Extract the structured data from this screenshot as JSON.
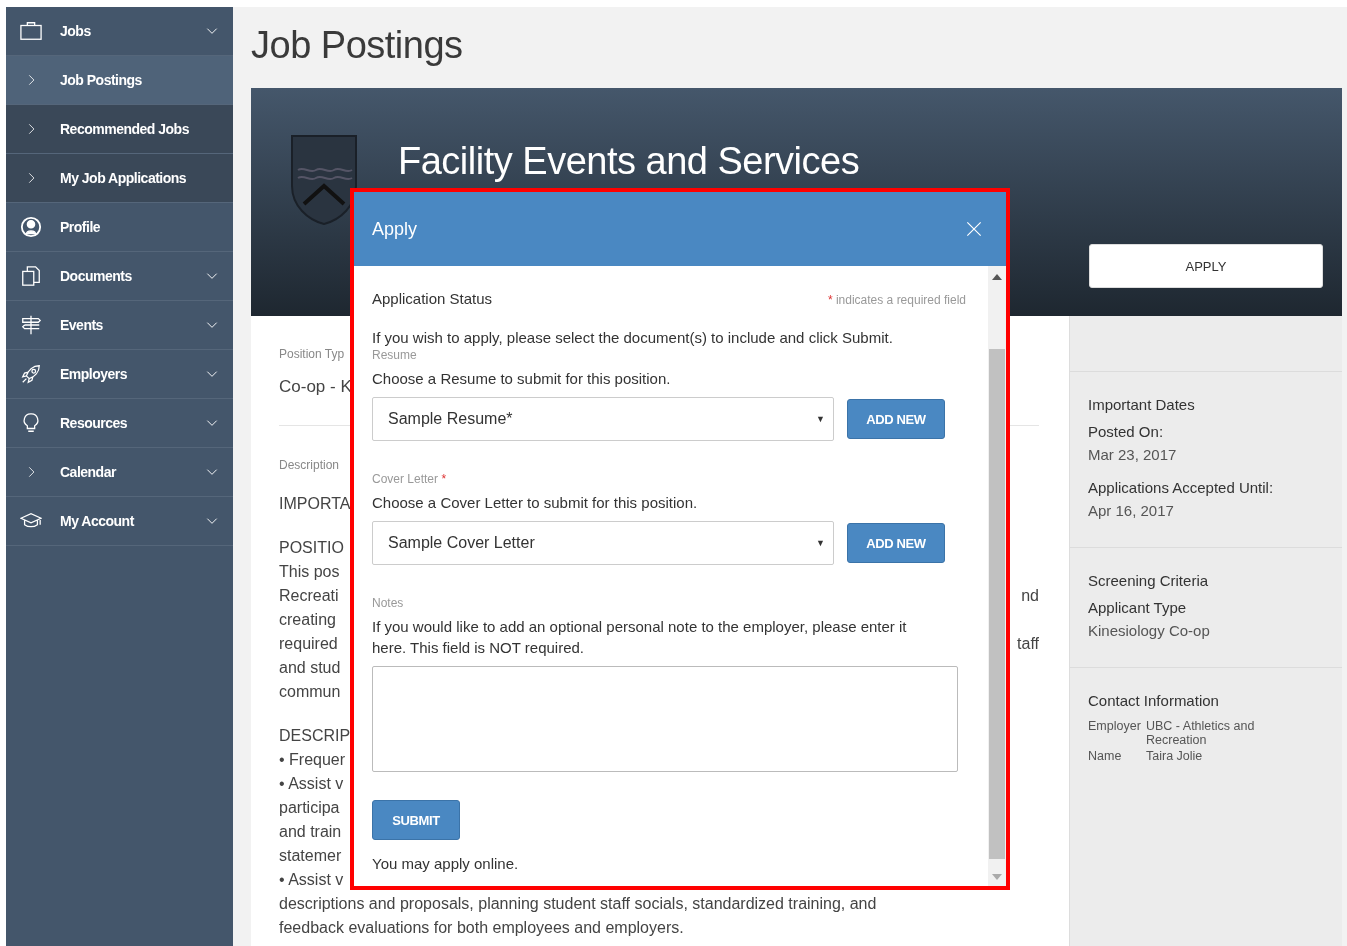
{
  "sidebar": {
    "items": [
      {
        "label": "Jobs",
        "kind": "section",
        "dropdown": true,
        "selected": false
      },
      {
        "label": "Job Postings",
        "kind": "subitem",
        "dropdown": false,
        "selected": true
      },
      {
        "label": "Recommended Jobs",
        "kind": "subitem",
        "dropdown": false,
        "selected": false
      },
      {
        "label": "My Job Applications",
        "kind": "subitem",
        "dropdown": false,
        "selected": false
      },
      {
        "label": "Profile",
        "kind": "section",
        "dropdown": false,
        "selected": false
      },
      {
        "label": "Documents",
        "kind": "section",
        "dropdown": true,
        "selected": false
      },
      {
        "label": "Events",
        "kind": "section",
        "dropdown": true,
        "selected": false
      },
      {
        "label": "Employers",
        "kind": "section",
        "dropdown": true,
        "selected": false
      },
      {
        "label": "Resources",
        "kind": "section",
        "dropdown": true,
        "selected": false
      },
      {
        "label": "Calendar",
        "kind": "section",
        "dropdown": true,
        "selected": false
      },
      {
        "label": "My Account",
        "kind": "section",
        "dropdown": true,
        "selected": false
      }
    ]
  },
  "page_title": "Job Postings",
  "banner": {
    "title": "Facility Events and Services",
    "apply_button": "APPLY"
  },
  "details": {
    "position_type_label": "Position Typ",
    "position_type": "Co-op - K",
    "description_label": "Description",
    "paragraphs": [
      [
        {
          "text": "IMPORTA"
        }
      ],
      [
        {
          "text": "POSITIO"
        },
        {
          "text": "This pos"
        },
        {
          "text": "Recreati",
          "tail": "nd"
        },
        {
          "text": "creating"
        },
        {
          "text": "required",
          "tail": "taff"
        },
        {
          "text": "and stud"
        },
        {
          "text": "commun"
        }
      ],
      [
        {
          "text": "DESCRIP"
        },
        {
          "text": "• Frequer"
        },
        {
          "text": "• Assist v"
        },
        {
          "text": "participa"
        },
        {
          "text": "and train"
        },
        {
          "text": "statemer"
        },
        {
          "text": "• Assist v"
        },
        {
          "text": "descriptions and proposals, planning student staff socials, standardized training, and"
        },
        {
          "text": "feedback evaluations for both employees and employers."
        }
      ]
    ]
  },
  "info_panel": {
    "sections": [
      {
        "title": "Important Dates",
        "kind": "stacked",
        "fields": [
          {
            "label": "Posted On:",
            "value": "Mar 23, 2017"
          },
          {
            "label": "Applications Accepted Until:",
            "value": "Apr 16, 2017"
          }
        ]
      },
      {
        "title": "Screening Criteria",
        "kind": "stacked",
        "fields": [
          {
            "label": "Applicant Type",
            "value": "Kinesiology Co-op"
          }
        ]
      },
      {
        "title": "Contact Information",
        "kind": "table",
        "fields": [
          {
            "label": "Employer",
            "value": "UBC - Athletics and Recreation"
          },
          {
            "label": "Name",
            "value": "Taira Jolie"
          }
        ]
      }
    ]
  },
  "modal": {
    "title": "Apply",
    "section_title": "Application Status",
    "required_mark": "*",
    "required_note": "indicates a required field",
    "intro": "If you wish to apply, please select the document(s) to include and click Submit.",
    "fields": [
      {
        "kind": "select",
        "label": "Resume",
        "hint": "Choose a Resume to submit for this position.",
        "value": "Sample Resume*",
        "caret": "▼",
        "button": "ADD NEW"
      },
      {
        "kind": "select",
        "label": "Cover Letter",
        "required_mark": "*",
        "hint": "Choose a Cover Letter to submit for this position.",
        "value": "Sample Cover Letter",
        "caret": "▼",
        "button": "ADD NEW"
      },
      {
        "kind": "textarea",
        "label": "Notes",
        "hint": "If you would like to add an optional personal note to the employer, please enter it here. This field is NOT required."
      }
    ],
    "submit": "SUBMIT",
    "footer": "You may apply online."
  }
}
